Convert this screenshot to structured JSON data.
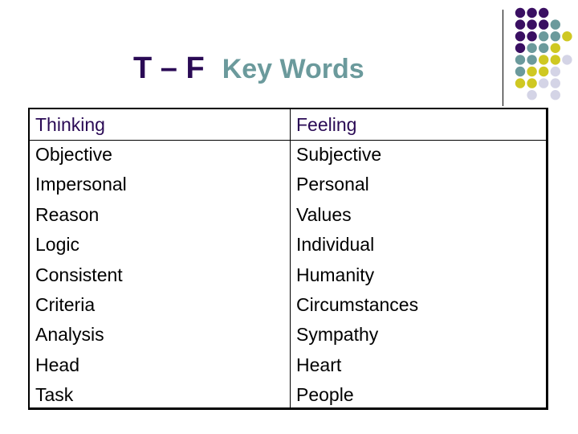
{
  "title": {
    "prefix": "T – F",
    "suffix": "Key Words"
  },
  "colors": {
    "title_prefix": "#2a0a55",
    "title_suffix": "#6b9a9c",
    "dot_purple": "#3a0f62",
    "dot_teal": "#6b9a9c",
    "dot_yellow": "#cfc822",
    "dot_lavender": "#d4d4e6"
  },
  "decoration": {
    "dot_grid": [
      [
        "purple",
        "purple",
        "purple",
        null,
        null
      ],
      [
        "purple",
        "purple",
        "purple",
        "teal",
        null
      ],
      [
        "purple",
        "purple",
        "teal",
        "teal",
        "yellow"
      ],
      [
        "purple",
        "teal",
        "teal",
        "yellow",
        null
      ],
      [
        "teal",
        "teal",
        "yellow",
        "yellow",
        "lavender"
      ],
      [
        "teal",
        "yellow",
        "yellow",
        "lavender",
        null
      ],
      [
        "yellow",
        "yellow",
        "lavender",
        "lavender",
        null
      ],
      [
        null,
        "lavender",
        null,
        "lavender",
        null
      ]
    ]
  },
  "table": {
    "columns": [
      {
        "header": "Thinking",
        "items": [
          "Objective",
          "Impersonal",
          "Reason",
          "Logic",
          "Consistent",
          "Criteria",
          "Analysis",
          "Head",
          "Task"
        ]
      },
      {
        "header": "Feeling",
        "items": [
          "Subjective",
          "Personal",
          "Values",
          "Individual",
          "Humanity",
          "Circumstances",
          "Sympathy",
          "Heart",
          "People"
        ]
      }
    ]
  }
}
